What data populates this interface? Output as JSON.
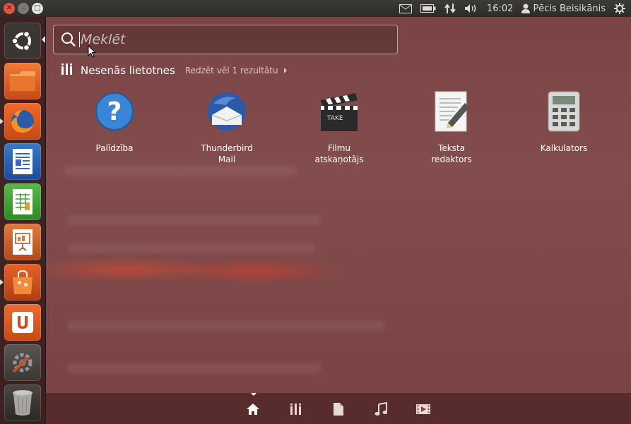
{
  "panel": {
    "time": "16:02",
    "user": "Pēcis Beisikānis"
  },
  "search": {
    "placeholder": "Meklēt"
  },
  "category": {
    "title": "Nesenās lietotnes",
    "more": "Redzēt vēl 1 rezultātu"
  },
  "apps": [
    {
      "label": "Palīdzība",
      "icon": "help-icon"
    },
    {
      "label": "Thunderbird\nMail",
      "icon": "thunderbird-icon"
    },
    {
      "label": "Filmu\natskaņotājs",
      "icon": "movie-player-icon"
    },
    {
      "label": "Teksta\nredaktors",
      "icon": "text-editor-icon"
    },
    {
      "label": "Kalkulators",
      "icon": "calculator-icon"
    }
  ],
  "launcher": [
    "ubuntu-button",
    "home-folder",
    "firefox",
    "libreoffice-writer",
    "libreoffice-calc",
    "libreoffice-impress",
    "software-center",
    "ubuntu-one",
    "system-settings",
    "trash"
  ],
  "lenses": [
    "home-lens",
    "applications-lens",
    "files-lens",
    "music-lens",
    "video-lens"
  ],
  "colors": {
    "dash_tint": "#8a5656",
    "panel": "#3c3b37",
    "close_button": "#e0533d"
  }
}
